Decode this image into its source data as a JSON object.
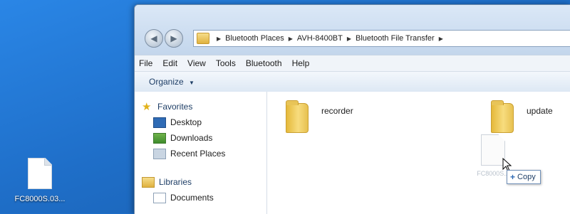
{
  "desktop": {
    "file_name": "FC8000S.03..."
  },
  "window": {
    "address": {
      "crumbs": [
        "Bluetooth Places",
        "AVH-8400BT",
        "Bluetooth File Transfer"
      ]
    },
    "menu": [
      "File",
      "Edit",
      "View",
      "Tools",
      "Bluetooth",
      "Help"
    ],
    "toolbar": {
      "organize_label": "Organize"
    },
    "navpane": {
      "favorites_label": "Favorites",
      "favorites": [
        "Desktop",
        "Downloads",
        "Recent Places"
      ],
      "libraries_label": "Libraries",
      "libraries": [
        "Documents"
      ]
    },
    "files": [
      {
        "name": "recorder"
      },
      {
        "name": "update"
      }
    ],
    "drag": {
      "ghost_name": "FC8000S...",
      "tooltip": "Copy"
    }
  },
  "colors": {
    "desktop_blue": "#1f6fc9",
    "folder_yellow": "#f7dc7e",
    "link_blue": "#1e3e66"
  }
}
